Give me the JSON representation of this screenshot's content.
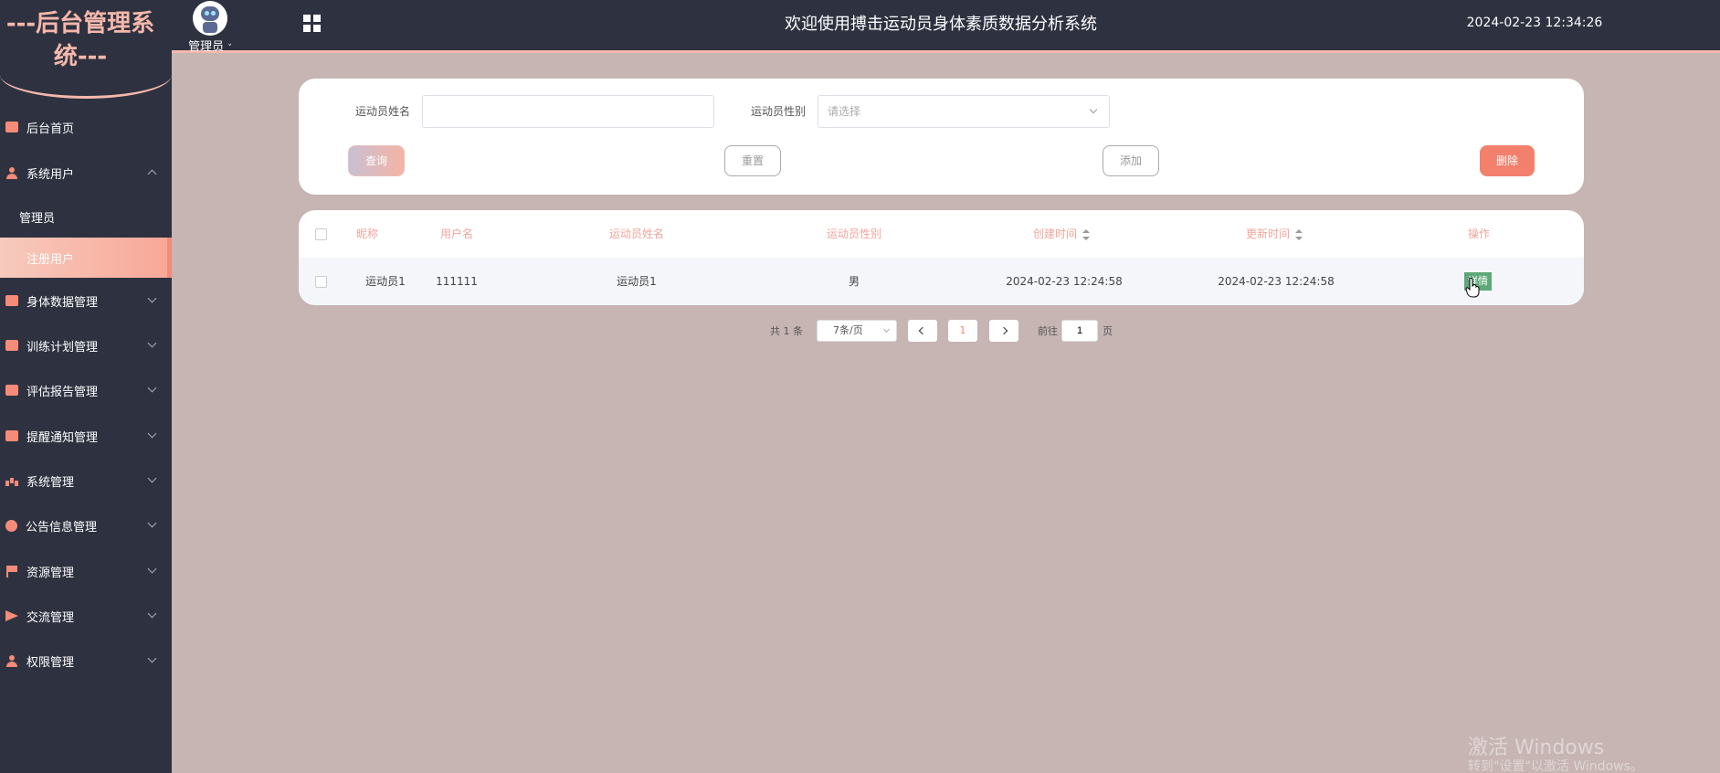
{
  "app": {
    "logo_text": "---后台管理系统---",
    "header_title": "欢迎使用搏击运动员身体素质数据分析系统",
    "datetime": "2024-02-23 12:34:26",
    "user_label": "管理员"
  },
  "sidebar": {
    "items": [
      {
        "label": "后台首页",
        "icon": "monitor-icon"
      },
      {
        "label": "系统用户",
        "icon": "user-icon",
        "expanded": true
      },
      {
        "label": "管理员",
        "sub": true
      },
      {
        "label": "注册用户",
        "sub": true,
        "active": true
      },
      {
        "label": "身体数据管理",
        "icon": "chart-icon"
      },
      {
        "label": "训练计划管理",
        "icon": "chart-icon"
      },
      {
        "label": "评估报告管理",
        "icon": "chart-icon"
      },
      {
        "label": "提醒通知管理",
        "icon": "chart-icon"
      },
      {
        "label": "系统管理",
        "icon": "bar-chart-icon"
      },
      {
        "label": "公告信息管理",
        "icon": "info-icon"
      },
      {
        "label": "资源管理",
        "icon": "flag-icon"
      },
      {
        "label": "交流管理",
        "icon": "paper-plane-icon"
      },
      {
        "label": "权限管理",
        "icon": "user-icon"
      }
    ]
  },
  "search": {
    "name_label": "运动员姓名",
    "name_value": "",
    "gender_label": "运动员性别",
    "gender_placeholder": "请选择",
    "query_label": "查询",
    "reset_label": "重置",
    "add_label": "添加",
    "delete_label": "删除"
  },
  "table": {
    "headers": [
      "昵称",
      "用户名",
      "运动员姓名",
      "运动员性别",
      "创建时间",
      "更新时间",
      "操作"
    ],
    "rows": [
      {
        "nickname": "运动员1",
        "username": "111111",
        "athlete_name": "运动员1",
        "gender": "男",
        "created": "2024-02-23 12:24:58",
        "updated": "2024-02-23 12:24:58",
        "action": "详情"
      }
    ]
  },
  "pagination": {
    "total": "共 1 条",
    "page_size": "7条/页",
    "current_page": "1",
    "goto_label": "前往",
    "goto_value": "1",
    "page_suffix": "页"
  },
  "watermark": {
    "line1": "激活 Windows",
    "line2": "转到\"设置\"以激活 Windows。"
  },
  "colors": {
    "sidebar_bg": "#2e3240",
    "accent": "#f6b8ab",
    "content_bg": "#c6b5b3",
    "delete": "#f3806d",
    "detail": "#5da879"
  }
}
